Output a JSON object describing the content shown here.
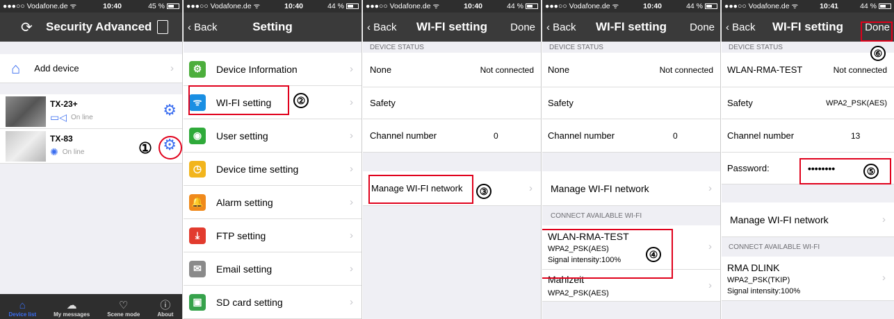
{
  "status_bars": [
    {
      "carrier": "●●●○○ Vodafone.de ᯤ",
      "time": "10:40",
      "battery": "45 %"
    },
    {
      "carrier": "●●●○○ Vodafone.de ᯤ",
      "time": "10:40",
      "battery": "44 %"
    },
    {
      "carrier": "●●●○○ Vodafone.de ᯤ",
      "time": "10:40",
      "battery": "44 %"
    },
    {
      "carrier": "●●●○○ Vodafone.de ᯤ",
      "time": "10:40",
      "battery": "44 %"
    },
    {
      "carrier": "●●●○○ Vodafone.de ᯤ",
      "time": "10:41",
      "battery": "44 %"
    }
  ],
  "p1": {
    "title": "Security Advanced",
    "add_device": "Add device",
    "devices": [
      {
        "name": "TX-23+",
        "status": "On line"
      },
      {
        "name": "TX-83",
        "status": "On line"
      }
    ],
    "step": "①",
    "tabs": [
      "Device list",
      "My messages",
      "Scene mode",
      "About"
    ]
  },
  "p2": {
    "back": "Back",
    "title": "Setting",
    "items": [
      {
        "label": "Device Information",
        "icon": "gear-cluster-icon",
        "color": "#4cae3c"
      },
      {
        "label": "WI-FI setting",
        "icon": "wifi-icon",
        "color": "#1a8fe3"
      },
      {
        "label": "User setting",
        "icon": "user-icon",
        "color": "#2faa3a"
      },
      {
        "label": "Device time setting",
        "icon": "clock-icon",
        "color": "#f2b51d"
      },
      {
        "label": "Alarm setting",
        "icon": "bell-icon",
        "color": "#f08a1c"
      },
      {
        "label": "FTP setting",
        "icon": "download-icon",
        "color": "#e23b2e"
      },
      {
        "label": "Email setting",
        "icon": "envelope-icon",
        "color": "#8a8a8a"
      },
      {
        "label": "SD card setting",
        "icon": "sd-card-icon",
        "color": "#36a24b"
      }
    ],
    "step": "②"
  },
  "wifi": {
    "back": "Back",
    "title": "WI-FI setting",
    "done": "Done",
    "device_status": "DEVICE STATUS",
    "safety": "Safety",
    "channel": "Channel number",
    "manage": "Manage WI-FI network",
    "connect": "CONNECT AVAILABLE WI-FI",
    "password_label": "Password:",
    "password_value": "••••••••"
  },
  "p3": {
    "name": "None",
    "state": "Not connected",
    "safety_value": "",
    "channel_value": "0",
    "step": "③"
  },
  "p4": {
    "name": "None",
    "state": "Not connected",
    "safety_value": "",
    "channel_value": "0",
    "step": "④",
    "networks": [
      {
        "ssid": "WLAN-RMA-TEST",
        "security": "WPA2_PSK(AES)",
        "signal": "Signal intensity:100%"
      },
      {
        "ssid": "Mahlzeit",
        "security": "WPA2_PSK(AES)"
      }
    ]
  },
  "p5": {
    "name": "WLAN-RMA-TEST",
    "state": "Not connected",
    "safety_value": "WPA2_PSK(AES)",
    "channel_value": "13",
    "step_done": "⑥",
    "step_pw": "⑤",
    "networks": [
      {
        "ssid": "RMA DLINK",
        "security": "WPA2_PSK(TKIP)",
        "signal": "Signal intensity:100%"
      }
    ]
  }
}
